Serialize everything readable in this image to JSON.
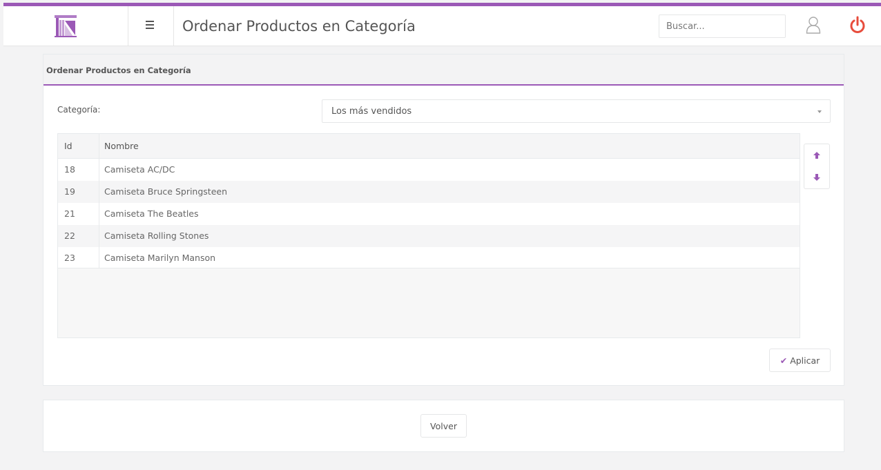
{
  "header": {
    "title": "Ordenar Productos en Categoría",
    "search_placeholder": "Buscar...",
    "accent_color": "#9b59b6",
    "power_color": "#e74c3c",
    "icons": [
      "logo-icon",
      "menu-icon",
      "user-icon",
      "power-icon"
    ]
  },
  "panel": {
    "title": "Ordenar Productos en Categoría",
    "category_label": "Categoría:",
    "category_value": "Los más vendidos"
  },
  "table": {
    "columns": [
      "Id",
      "Nombre"
    ],
    "rows": [
      {
        "id": "18",
        "name": "Camiseta AC/DC"
      },
      {
        "id": "19",
        "name": "Camiseta Bruce Springsteen"
      },
      {
        "id": "21",
        "name": "Camiseta The Beatles"
      },
      {
        "id": "22",
        "name": "Camiseta Rolling Stones"
      },
      {
        "id": "23",
        "name": "Camiseta Marilyn Manson"
      }
    ]
  },
  "actions": {
    "apply_label": "Aplicar",
    "back_label": "Volver"
  }
}
